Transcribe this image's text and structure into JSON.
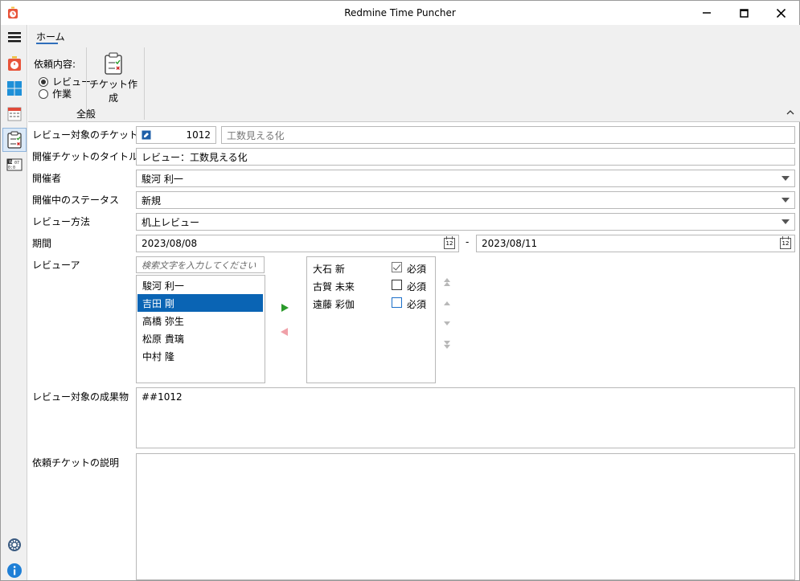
{
  "window": {
    "title": "Redmine Time Puncher",
    "controls": [
      "minimize",
      "maximize",
      "close"
    ]
  },
  "nav": {
    "items": [
      "timer-icon",
      "dashboard-icon",
      "calendar-icon",
      "ticket-review-icon",
      "time-table-icon"
    ],
    "bottom": [
      "settings-icon",
      "info-icon"
    ],
    "active": "ticket-review-icon"
  },
  "ribbon": {
    "tab_label": "ホーム",
    "request_kind_label": "依頼内容:",
    "radio_review": "レビュー",
    "radio_work": "作業",
    "create_ticket_label": "チケット作成",
    "group_label": "全般"
  },
  "form": {
    "ticket_no_label": "レビュー対象のチケット番号",
    "ticket_no_value": "1012",
    "ticket_subject": "工数見える化",
    "title_label": "開催チケットのタイトル",
    "title_value": "レビュー：工数見える化",
    "host_label": "開催者",
    "host_value": "駿河 利一",
    "status_label": "開催中のステータス",
    "status_value": "新規",
    "method_label": "レビュー方法",
    "method_value": "机上レビュー",
    "period_label": "期間",
    "period_start": "2023/08/08",
    "period_sep": "-",
    "period_end": "2023/08/11",
    "cal_day": "12",
    "reviewer_label": "レビューア",
    "search_placeholder": "検索文字を入力してください",
    "candidates": [
      "駿河 利一",
      "吉田 剛",
      "高橋 弥生",
      "松原 貴璃",
      "中村 隆"
    ],
    "selected_candidate": "吉田 剛",
    "reviewers": [
      {
        "name": "大石 新",
        "required_label": "必須",
        "required": true
      },
      {
        "name": "古賀 未来",
        "required_label": "必須",
        "required": false
      },
      {
        "name": "遠藤 彩伽",
        "required_label": "必須",
        "required": false
      }
    ],
    "deliverables_label": "レビュー対象の成果物",
    "deliverables_value": "##1012",
    "description_label": "依頼チケットの説明",
    "description_value": ""
  },
  "colors": {
    "accent": "#2f6ebb",
    "selection": "#0a64b4",
    "add_arrow": "#2a9a2a",
    "remove_arrow": "#f0a0a8"
  }
}
